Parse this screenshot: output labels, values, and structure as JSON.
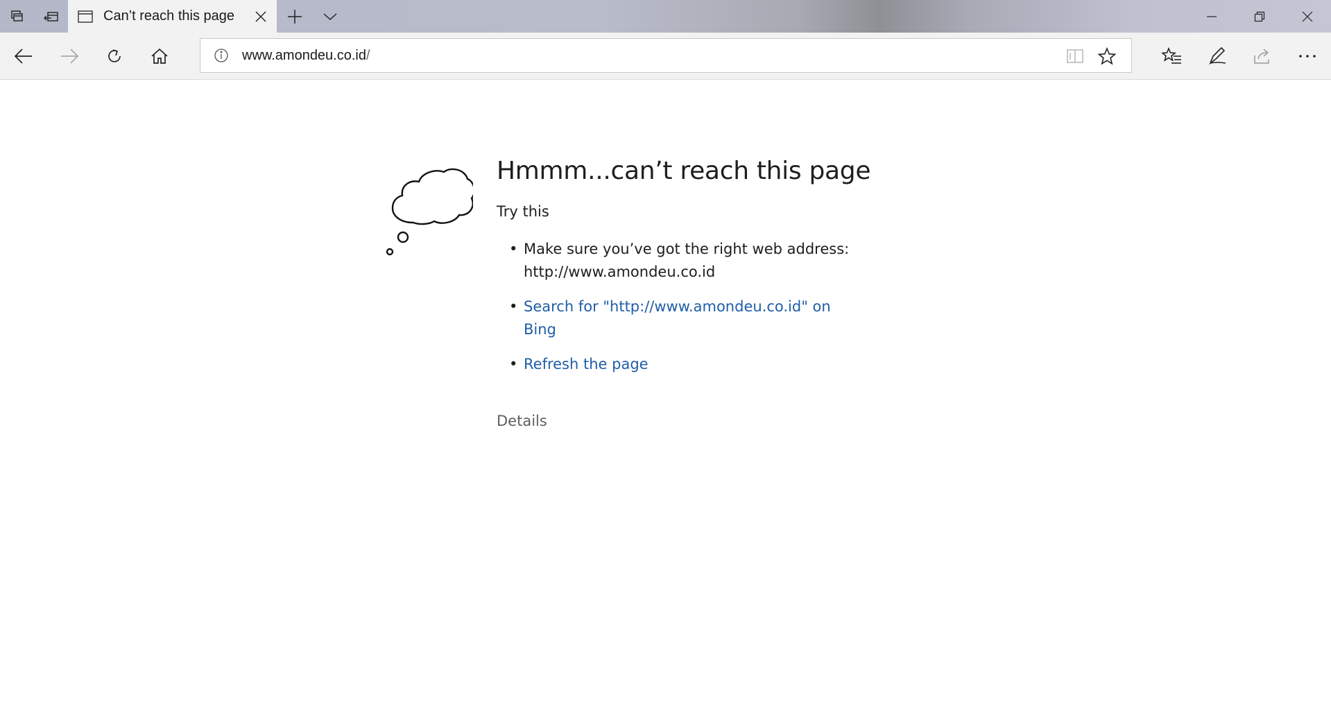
{
  "titlebar": {
    "tab_title": "Can’t reach this page",
    "icons": {
      "tab_manager": "tabs-aside-icon",
      "restore_tabs": "restore-tabs-icon",
      "page": "page-icon",
      "close_tab": "close-icon",
      "new_tab": "plus-icon",
      "tab_list": "chevron-down-icon",
      "minimize": "minimize-icon",
      "maximize": "restore-window-icon",
      "close_window": "close-window-icon"
    }
  },
  "navbar": {
    "url_host": "www.amondeu.co.id",
    "url_path": "/",
    "icons": {
      "back": "back-arrow-icon",
      "forward": "forward-arrow-icon",
      "refresh": "refresh-icon",
      "home": "home-icon",
      "site_info": "info-icon",
      "reading_view": "reading-view-icon",
      "favorite": "star-icon",
      "favorites_hub": "favorites-list-icon",
      "web_note": "pen-icon",
      "share": "share-icon",
      "more": "more-icon"
    }
  },
  "error_page": {
    "title": "Hmmm...can’t reach this page",
    "try_this": "Try this",
    "suggestions": [
      {
        "text": "Make sure you’ve got the right web address: http://www.amondeu.co.id"
      },
      {
        "text": "Search for \"http://www.amondeu.co.id\" on Bing"
      },
      {
        "text": "Refresh the page"
      }
    ],
    "details": "Details"
  },
  "colors": {
    "link": "#1f5ea7",
    "text": "#1e1e1e",
    "muted": "#5f5f5f",
    "chrome_bg": "#f2f2f2"
  }
}
